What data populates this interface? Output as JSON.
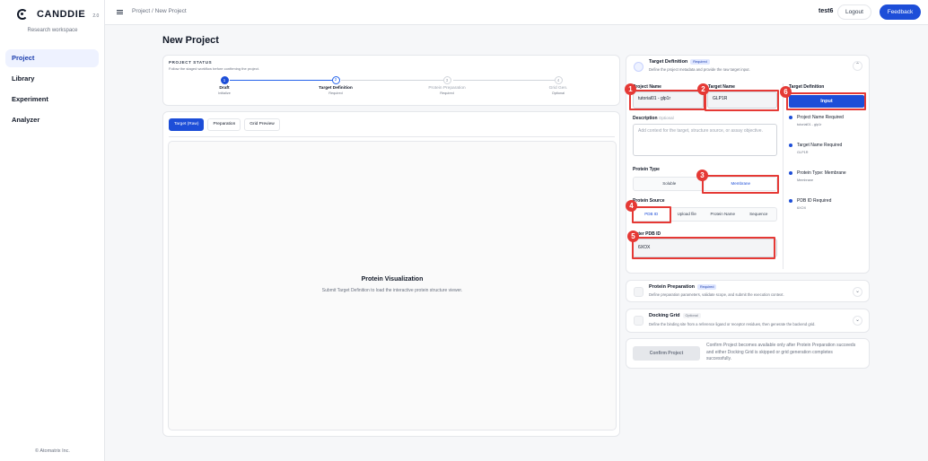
{
  "sidebar": {
    "brand": "CANDDIE",
    "version": "2.0",
    "workspace": "Research workspace",
    "items": [
      {
        "label": "Project",
        "active": true
      },
      {
        "label": "Library",
        "active": false
      },
      {
        "label": "Experiment",
        "active": false
      },
      {
        "label": "Analyzer",
        "active": false
      }
    ],
    "footer": "© Atomatrix Inc."
  },
  "topbar": {
    "breadcrumb": "Project / New Project",
    "user": "test6",
    "logout_label": "Logout",
    "feedback_label": "Feedback"
  },
  "page_title": "New Project",
  "project_status": {
    "title": "PROJECT STATUS",
    "subtitle": "Follow the staged workflow before confirming the project.",
    "steps": [
      {
        "num": "1",
        "label": "Draft",
        "sub": "Initialize"
      },
      {
        "num": "2",
        "label": "Target Definition",
        "sub": "Required"
      },
      {
        "num": "3",
        "label": "Protein Preparation",
        "sub": "Required"
      },
      {
        "num": "4",
        "label": "Grid Gen.",
        "sub": "Optional"
      }
    ]
  },
  "viewer": {
    "tabs": [
      "Target (Raw)",
      "Preparation",
      "Grid Preview"
    ],
    "title": "Protein Visualization",
    "subtitle": "Submit Target Definition to load the interactive protein structure viewer."
  },
  "target_definition": {
    "title": "Target Definition",
    "badge": "Required",
    "subtitle": "Define the project metadata and provide the raw target input.",
    "project_name_label": "Project Name",
    "project_name_value": "tutorial01 - glp1r",
    "target_name_label": "Target Name",
    "target_name_value": "GLP1R",
    "description_label": "Description",
    "description_optional": "Optional",
    "description_placeholder": "Add context for the target, structure source, or assay objective.",
    "protein_type_label": "Protein Type",
    "protein_types": [
      "Soluble",
      "Membrane"
    ],
    "protein_source_label": "Protein Source",
    "protein_sources": [
      "PDB ID",
      "Upload file",
      "Protein Name",
      "Sequence"
    ],
    "pdb_label": "Enter PDB ID",
    "pdb_value": "6XOX",
    "right_title": "Target Definition",
    "input_button": "Input",
    "checklist": [
      {
        "label": "Project Name Required",
        "value": "tutorial01 - glp1r"
      },
      {
        "label": "Target Name Required",
        "value": "GLP1R"
      },
      {
        "label": "Protein Type: Membrane",
        "value": "Membrane"
      },
      {
        "label": "PDB ID Required",
        "value": "6XOX"
      }
    ]
  },
  "protein_preparation": {
    "title": "Protein Preparation",
    "badge": "Required",
    "subtitle": "Define preparation parameters, validate scope, and submit the execution context."
  },
  "docking_grid": {
    "title": "Docking Grid",
    "badge": "Optional",
    "subtitle": "Define the binding site from a reference ligand or receptor residues, then generate the backend grid."
  },
  "confirm": {
    "button": "Confirm Project",
    "note": "Confirm Project becomes available only after Protein Preparation succeeds and either Docking Grid is skipped or grid generation completes successfully."
  },
  "annotations": [
    "1",
    "2",
    "3",
    "4",
    "5",
    "6"
  ],
  "colors": {
    "accent": "#1d4ed8",
    "annotation": "#e53935"
  }
}
